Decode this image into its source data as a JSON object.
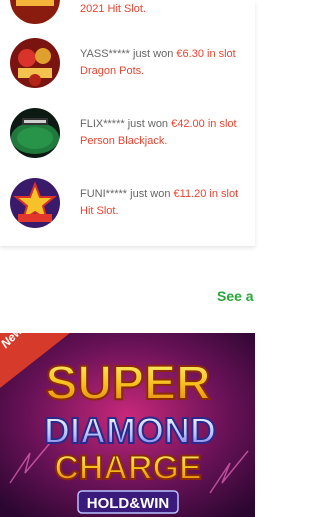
{
  "winners": [
    {
      "partial_game": "2021 Hit Slot.",
      "thumb_icon": "hot-slot-icon"
    },
    {
      "user": "YASS*****",
      "won_text": " just won ",
      "amount": "€6.30",
      "in_text": " in slot",
      "game": "Dragon Pots.",
      "thumb_icon": "dragon-pots-icon"
    },
    {
      "user": "FLIX*****",
      "won_text": " just won ",
      "amount": "€42.00",
      "in_text": " in slot",
      "game": "Person Blackjack.",
      "thumb_icon": "blackjack-table-icon"
    },
    {
      "user": "FUNI*****",
      "won_text": " just won ",
      "amount": "€11.20",
      "in_text": " in slot",
      "game": "Hit Slot.",
      "thumb_icon": "star-slot-icon"
    }
  ],
  "see_all_label": "See a",
  "banner": {
    "ribbon": "New",
    "title_line1": "SUPER",
    "title_line2": "DIAMOND",
    "title_line3": "CHARGE",
    "subtitle": "HOLD&WIN"
  },
  "colors": {
    "amount": "#e8442f",
    "see_all": "#2aa63a",
    "ribbon": "#d63a2a"
  }
}
